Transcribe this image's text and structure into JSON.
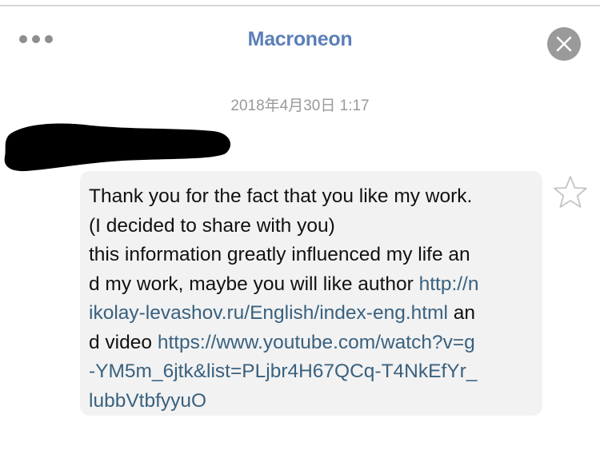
{
  "header": {
    "title": "Macroneon",
    "more_icon": "more-horizontal-icon",
    "close_icon": "close-icon"
  },
  "message": {
    "timestamp": "2018年4月30日 1:17",
    "sender_redacted": true,
    "lines": [
      [
        {
          "t": "Thank you for the fact that you like my work.",
          "link": false
        }
      ],
      [
        {
          "t": "(I decided to share with you)",
          "link": false
        }
      ],
      [
        {
          "t": "this information greatly influenced my life an",
          "link": false
        }
      ],
      [
        {
          "t": "d my work, maybe you will like author ",
          "link": false
        },
        {
          "t": "http://n",
          "link": true
        }
      ],
      [
        {
          "t": "ikolay-levashov.ru/English/index-eng.html",
          "link": true
        },
        {
          "t": " an",
          "link": false
        }
      ],
      [
        {
          "t": "d video ",
          "link": false
        },
        {
          "t": "https://www.youtube.com/watch?v=g",
          "link": true
        }
      ],
      [
        {
          "t": "-YM5m_6jtk&list=PLjbr4H67QCq-T4NkEfYr_",
          "link": true
        }
      ],
      [
        {
          "t": "lubbVtbfyyuO",
          "link": true
        }
      ]
    ],
    "star_icon": "star-outline-icon"
  },
  "colors": {
    "title": "#5b7fb8",
    "link": "#39617f",
    "bubble": "#f2f2f2",
    "timestamp": "#9a9a9a"
  }
}
